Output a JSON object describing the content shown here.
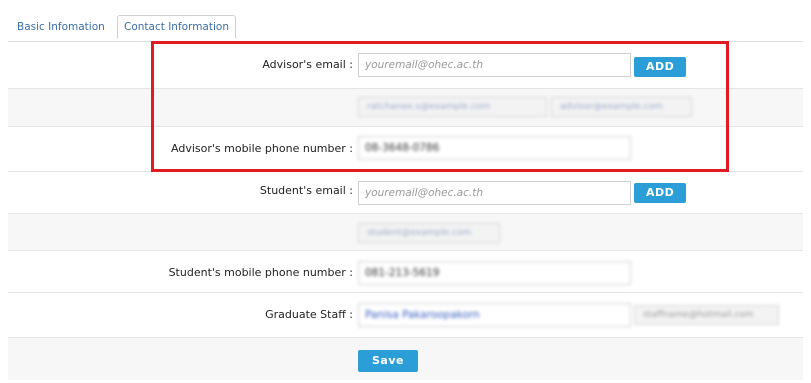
{
  "tabs": [
    {
      "label": "Basic Infomation",
      "active": false
    },
    {
      "label": "Contact Information",
      "active": true
    }
  ],
  "form": {
    "advisor_email_label": "Advisor's email :",
    "advisor_email_placeholder": "youremail@ohec.ac.th",
    "add_label": "ADD",
    "advisor_emails": [
      "ratchanee.s@example.com",
      "advisor@example.com"
    ],
    "advisor_phone_label": "Advisor's mobile phone number :",
    "advisor_phone_value": "08-3648-0786",
    "student_email_label": "Student's email :",
    "student_email_placeholder": "youremail@ohec.ac.th",
    "student_emails": [
      "student@example.com"
    ],
    "student_phone_label": "Student's mobile phone number :",
    "student_phone_value": "081-213-5619",
    "graduate_staff_label": "Graduate Staff :",
    "graduate_staff_value": "Panisa Pakaroopakorn",
    "graduate_staff_email": "staffname@hotmail.com",
    "save_label": "Save"
  },
  "colors": {
    "accent": "#2b9ed7",
    "highlight": "#e11b24"
  }
}
